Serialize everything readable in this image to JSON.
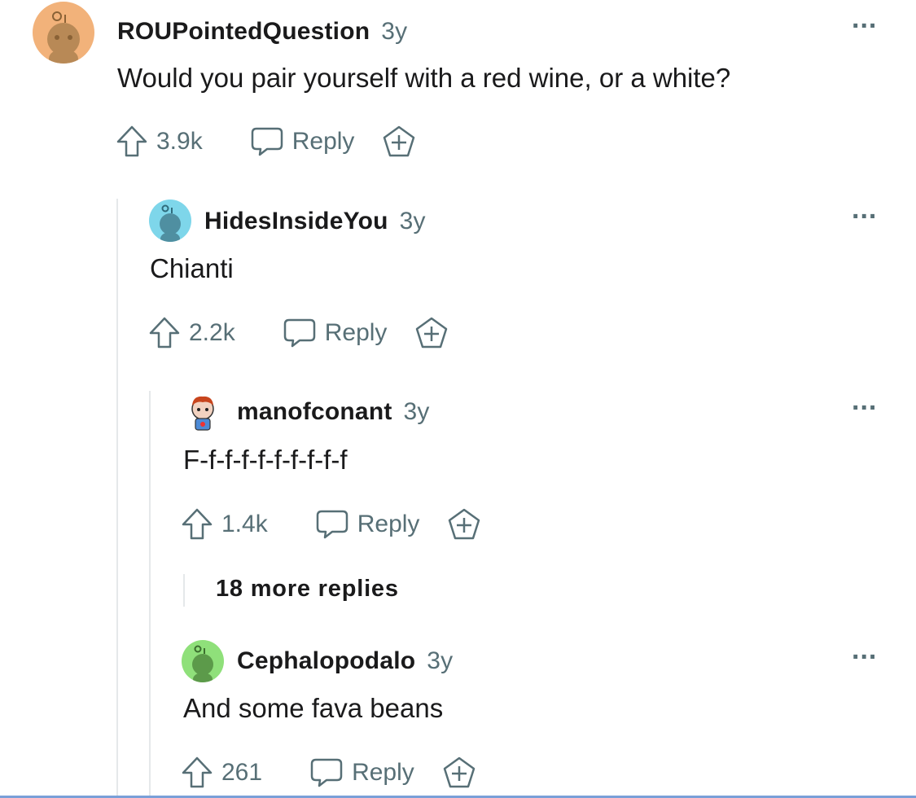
{
  "comments": [
    {
      "username": "ROUPointedQuestion",
      "age": "3y",
      "text": "Would you pair yourself with a red wine, or a white?",
      "votes": "3.9k",
      "reply_label": "Reply",
      "avatar_color": "#f2b27a"
    },
    {
      "username": "HidesInsideYou",
      "age": "3y",
      "text": "Chianti",
      "votes": "2.2k",
      "reply_label": "Reply",
      "avatar_color": "#7ed6ea"
    },
    {
      "username": "manofconant",
      "age": "3y",
      "text": "F-f-f-f-f-f-f-f-f-f",
      "votes": "1.4k",
      "reply_label": "Reply",
      "avatar_color": "#ffffff"
    },
    {
      "username": "Cephalopodalo",
      "age": "3y",
      "text": "And some fava beans",
      "votes": "261",
      "reply_label": "Reply",
      "avatar_color": "#8fe07a"
    }
  ],
  "more_replies_label": "18 more replies",
  "more_menu_glyph": "..."
}
